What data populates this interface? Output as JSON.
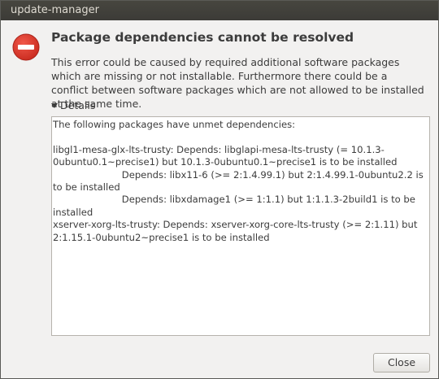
{
  "window": {
    "title": "update-manager"
  },
  "dialog": {
    "icon": "error-icon",
    "heading": "Package dependencies cannot be resolved",
    "message": "This error could be caused by required additional software packages which are missing or not installable. Furthermore there could be a conflict between software packages which are not allowed to be installed at the same time.",
    "details_label": "Details",
    "details_text": "The following packages have unmet dependencies:\n\nlibgl1-mesa-glx-lts-trusty: Depends: libglapi-mesa-lts-trusty (= 10.1.3-0ubuntu0.1~precise1) but 10.1.3-0ubuntu0.1~precise1 is to be installed\n                       Depends: libx11-6 (>= 2:1.4.99.1) but 2:1.4.99.1-0ubuntu2.2 is to be installed\n                       Depends: libxdamage1 (>= 1:1.1) but 1:1.1.3-2build1 is to be installed\nxserver-xorg-lts-trusty: Depends: xserver-xorg-core-lts-trusty (>= 2:1.11) but 2:1.15.1-0ubuntu2~precise1 is to be installed",
    "close_label": "Close"
  },
  "colors": {
    "error_red": "#df382c",
    "titlebar": "#3c3b37"
  }
}
